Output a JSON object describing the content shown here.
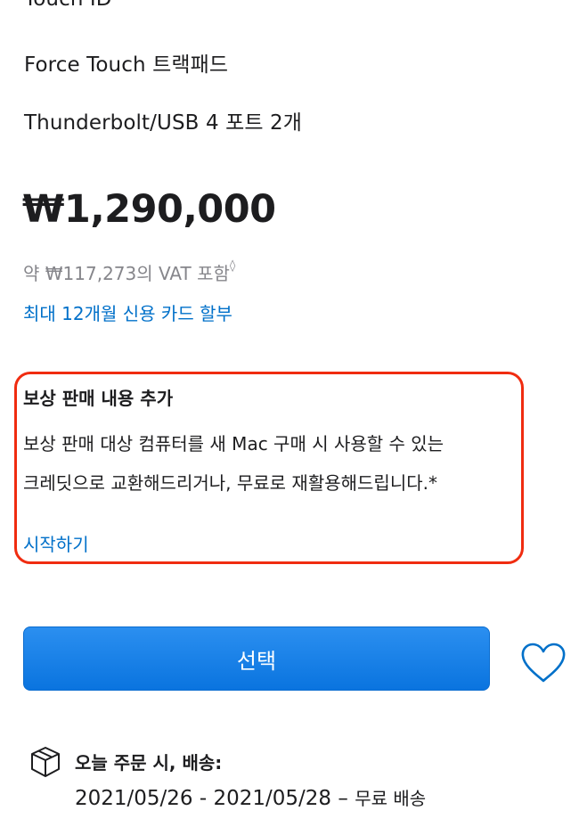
{
  "specs": [
    "Touch ID",
    "Force Touch 트랙패드",
    "Thunderbolt/USB 4 포트 2개"
  ],
  "price": {
    "amount": "₩1,290,000",
    "vat_note": "약 ₩117,273의 VAT 포함",
    "vat_mark": "◊",
    "installment_link": "최대 12개월 신용 카드 할부"
  },
  "trade_in": {
    "title": "보상 판매 내용 추가",
    "description_line1": "보상 판매 대상 컴퓨터를 새 Mac 구매 시 사용할 수 있는",
    "description_line2": "크레딧으로 교환해드리거나, 무료로 재활용해드립니다.*",
    "link": "시작하기",
    "highlight_color": "#f02c10"
  },
  "actions": {
    "select_label": "선택",
    "favorite_icon": "heart-outline-icon"
  },
  "delivery": {
    "icon": "box-icon",
    "label": "오늘 주문 시, 배송:",
    "dates": "2021/05/26 - 2021/05/28",
    "separator": " – ",
    "shipping": "무료 배송"
  },
  "colors": {
    "link": "#0070c9",
    "button": "#0a74df",
    "text": "#1d1d1f",
    "muted": "#86868b"
  }
}
